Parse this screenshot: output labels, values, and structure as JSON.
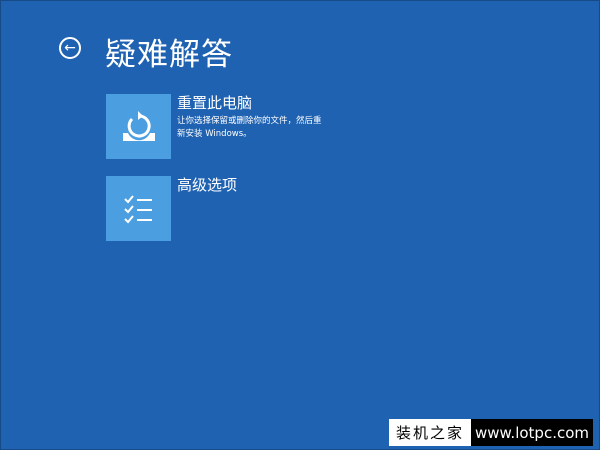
{
  "header": {
    "title": "疑难解答",
    "back_icon": "arrow-left-circle-icon"
  },
  "options": [
    {
      "title": "重置此电脑",
      "description": "让你选择保留或删除你的文件，然后重新安装 Windows。",
      "icon": "reset-pc-icon"
    },
    {
      "title": "高级选项",
      "description": "",
      "icon": "checklist-icon"
    }
  ],
  "watermark": {
    "cn": "装机之家",
    "url": "www.lotpc.com"
  },
  "colors": {
    "background": "#1f62b1",
    "tile": "#4b9ee0"
  }
}
